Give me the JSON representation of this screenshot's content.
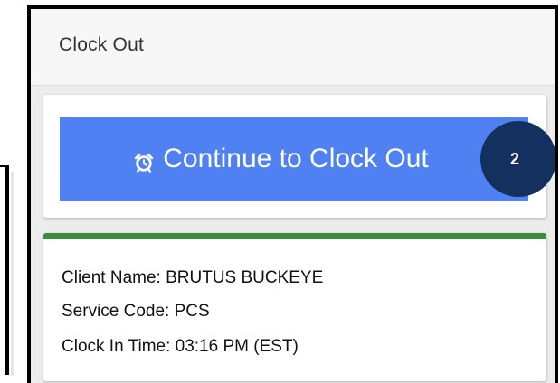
{
  "header": {
    "title": "Clock Out"
  },
  "actions": {
    "continue_label": "Continue to Clock Out",
    "continue_icon": "alarm-clock-icon",
    "step_badge": "2"
  },
  "colors": {
    "primary_button": "#4f81f2",
    "badge": "#13305f",
    "status_bar": "#3e8a3e"
  },
  "visit": {
    "client_name": "Client Name: BRUTUS BUCKEYE",
    "service_code": "Service Code: PCS",
    "clock_in_time": "Clock In Time: 03:16 PM (EST)"
  }
}
